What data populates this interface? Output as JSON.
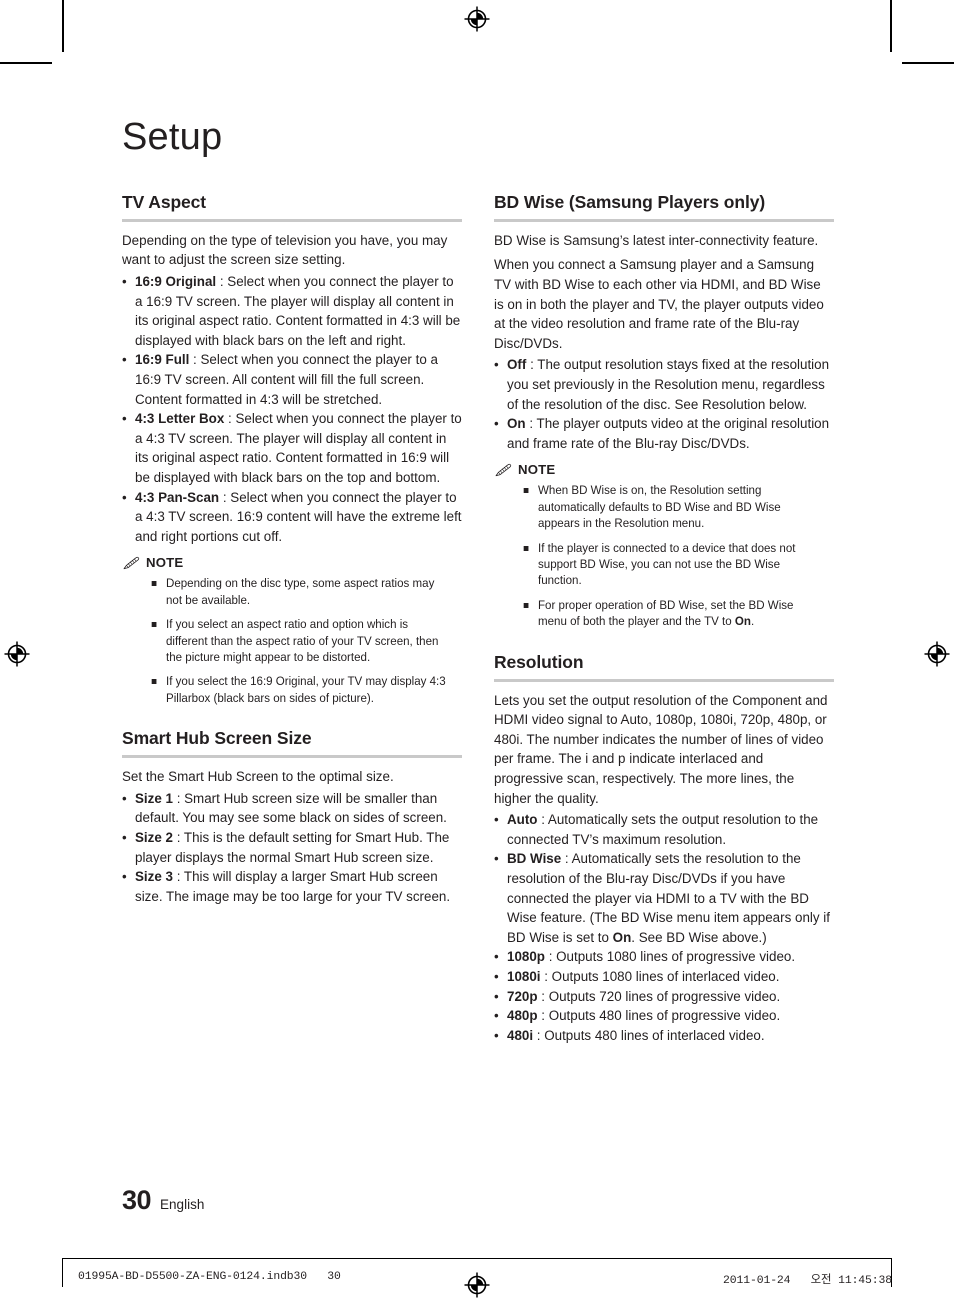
{
  "page": {
    "chapter_title": "Setup",
    "page_number": "30",
    "language": "English"
  },
  "production": {
    "file_label": "01995A-BD-D5500-ZA-ENG-0124.indb30   30",
    "timestamp": "2011-01-24   오전 11:45:38"
  },
  "left_column": {
    "sections": [
      {
        "heading": "TV Aspect",
        "intro": "Depending on the type of television you have, you may want to adjust the screen size setting.",
        "bullets": [
          {
            "term": "16:9 Original",
            "text": " : Select when you connect the player to a 16:9 TV screen. The player will display all content in its original aspect ratio. Content formatted in 4:3 will be displayed with black bars on the left and right."
          },
          {
            "term": "16:9 Full",
            "text": " : Select when you connect the player to a 16:9 TV screen. All content will fill the full screen. Content formatted in 4:3 will be stretched."
          },
          {
            "term": "4:3 Letter Box",
            "text": " : Select when you connect the player to a 4:3 TV screen. The player will display all content in its original aspect ratio. Content formatted in 16:9 will be displayed with black bars on the top and bottom."
          },
          {
            "term": "4:3 Pan-Scan",
            "text": " : Select when you connect the player to a 4:3 TV screen. 16:9 content will have the extreme left and right portions cut off."
          }
        ],
        "note": {
          "title": "NOTE",
          "items": [
            "Depending on the disc type, some aspect ratios may not be available.",
            "If you select an aspect ratio and option which is different than the aspect ratio of your TV screen, then the picture might appear to be distorted.",
            "If you select the 16:9 Original, your TV may display 4:3 Pillarbox (black bars on sides of picture)."
          ]
        }
      },
      {
        "heading": "Smart Hub Screen Size",
        "intro": "Set the Smart Hub Screen to the optimal size.",
        "bullets": [
          {
            "term": "Size 1",
            "text": " : Smart Hub screen size will be smaller than default. You may see some black on sides of screen."
          },
          {
            "term": "Size 2",
            "text": " : This is the default setting for Smart Hub. The player displays the normal Smart Hub screen size."
          },
          {
            "term": "Size 3",
            "text": " : This will display a larger Smart Hub screen size. The image may be too large for your TV screen."
          }
        ]
      }
    ]
  },
  "right_column": {
    "sections": [
      {
        "heading": "BD Wise (Samsung Players only)",
        "paragraphs": [
          "BD Wise is Samsung’s latest inter-connectivity feature.",
          "When you connect a Samsung player and a Samsung TV with BD Wise to each other via HDMI, and BD Wise is on in both the player and TV, the player outputs video at the video resolution and frame rate of the Blu-ray Disc/DVDs."
        ],
        "bullets": [
          {
            "term": "Off",
            "text": " : The output resolution stays fixed at the resolution you set previously in the Resolution menu, regardless of the resolution of the disc. See Resolution below."
          },
          {
            "term": "On",
            "text": " : The player outputs video at the original resolution and frame rate of the Blu-ray Disc/DVDs."
          }
        ],
        "note": {
          "title": "NOTE",
          "items_html": [
            "When BD Wise is on, the Resolution setting automatically defaults to BD Wise and BD Wise appears in the Resolution menu.",
            "If the player is connected to a device that does not support BD Wise, you can not use the BD Wise function.",
            "For proper operation of BD Wise, set the BD Wise menu of both the player and the TV to <b>On</b>."
          ]
        }
      },
      {
        "heading": "Resolution",
        "intro": "Lets you set the output resolution of the Component and HDMI video signal to Auto, 1080p, 1080i, 720p, 480p, or 480i. The number indicates the number of lines of video per frame. The i and p indicate interlaced and progressive scan, respectively. The more lines, the higher the quality.",
        "bullets_html": [
          {
            "term": "Auto",
            "text": " : Automatically sets the output resolution to the connected TV’s maximum resolution."
          },
          {
            "term": "BD Wise",
            "text": " : Automatically sets the resolution to the resolution of the Blu-ray Disc/DVDs if you have connected the player via HDMI to a TV with the BD Wise feature. (The BD Wise menu item appears only if BD Wise is set to <b>On</b>. See BD Wise above.)"
          },
          {
            "term": "1080p",
            "text": " : Outputs 1080 lines of progressive video."
          },
          {
            "term": "1080i",
            "text": " : Outputs 1080 lines of interlaced video."
          },
          {
            "term": "720p",
            "text": " : Outputs 720 lines of progressive video."
          },
          {
            "term": "480p",
            "text": " : Outputs 480 lines of progressive video."
          },
          {
            "term": "480i",
            "text": " : Outputs 480 lines of interlaced video."
          }
        ]
      }
    ]
  }
}
